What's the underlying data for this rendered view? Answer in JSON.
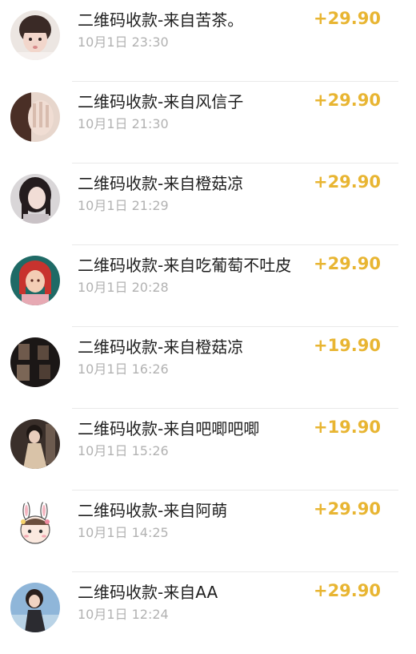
{
  "theme": {
    "amount_color": "#e8b532",
    "title_color": "#1f1f1f",
    "time_color": "#b2b2b2"
  },
  "transactions": [
    {
      "title": "二维码收款-来自苦茶。",
      "time": "10月1日 23:30",
      "amount": "+29.90",
      "avatar": "avatar-girl-icon"
    },
    {
      "title": "二维码收款-来自风信子",
      "time": "10月1日 21:30",
      "amount": "+29.90",
      "avatar": "avatar-hand-icon"
    },
    {
      "title": "二维码收款-来自橙菇凉",
      "time": "10月1日 21:29",
      "amount": "+29.90",
      "avatar": "avatar-woman-icon"
    },
    {
      "title": "二维码收款-来自吃葡萄不吐皮",
      "time": "10月1日 20:28",
      "amount": "+29.90",
      "avatar": "avatar-anime-icon"
    },
    {
      "title": "二维码收款-来自橙菇凉",
      "time": "10月1日 16:26",
      "amount": "+19.90",
      "avatar": "avatar-dark-icon"
    },
    {
      "title": "二维码收款-来自吧唧吧唧",
      "time": "10月1日 15:26",
      "amount": "+19.90",
      "avatar": "avatar-dress-icon"
    },
    {
      "title": "二维码收款-来自阿萌",
      "time": "10月1日 14:25",
      "amount": "+29.90",
      "avatar": "avatar-bunny-icon"
    },
    {
      "title": "二维码收款-来自AA",
      "time": "10月1日 12:24",
      "amount": "+29.90",
      "avatar": "avatar-sky-icon"
    }
  ]
}
